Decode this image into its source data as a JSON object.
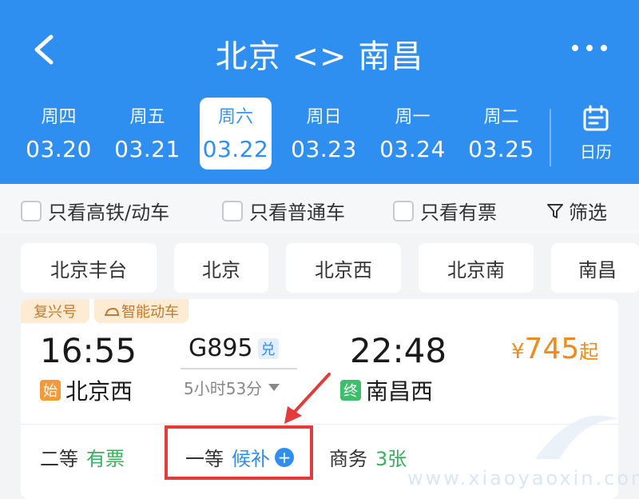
{
  "header": {
    "title": "北京 <> 南昌",
    "dates": [
      {
        "weekday": "周四",
        "date": "03.20",
        "selected": false
      },
      {
        "weekday": "周五",
        "date": "03.21",
        "selected": false
      },
      {
        "weekday": "周六",
        "date": "03.22",
        "selected": true
      },
      {
        "weekday": "周日",
        "date": "03.23",
        "selected": false
      },
      {
        "weekday": "周一",
        "date": "03.24",
        "selected": false
      },
      {
        "weekday": "周二",
        "date": "03.25",
        "selected": false
      }
    ],
    "calendar_label": "日历"
  },
  "filters": {
    "high_speed_only": "只看高铁/动车",
    "regular_only": "只看普通车",
    "available_only": "只看有票",
    "filter_label": "筛选"
  },
  "stations": [
    "北京丰台",
    "北京",
    "北京西",
    "北京南",
    "南昌"
  ],
  "train": {
    "tags": [
      "复兴号",
      "智能动车"
    ],
    "departure_time": "16:55",
    "arrival_time": "22:48",
    "train_number": "G895",
    "redeem_badge": "兑",
    "duration": "5小时53分",
    "departure_station": "北京西",
    "arrival_station": "南昌西",
    "start_badge": "始",
    "end_badge": "终",
    "price_currency": "¥",
    "price_value": "745",
    "price_suffix": "起",
    "seats": [
      {
        "class": "二等",
        "status": "有票"
      },
      {
        "class": "一等",
        "status": "候补"
      },
      {
        "class": "商务",
        "status": "3张"
      }
    ]
  },
  "watermark": "www.xiaoyaoxin.com",
  "colors": {
    "header_blue": "#2f8ff0",
    "price_orange": "#f08b1a",
    "available_green": "#36b15c",
    "highlight_red": "#e33b3b"
  }
}
